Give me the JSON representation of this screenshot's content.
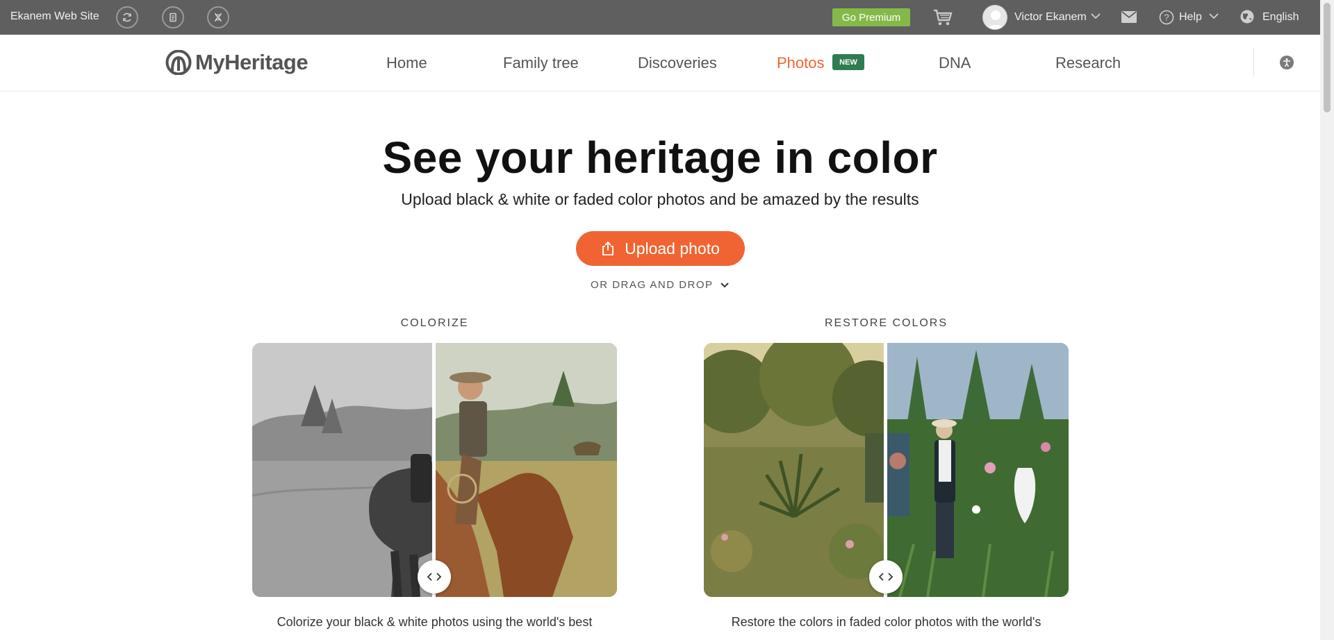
{
  "topbar": {
    "site_name": "Ekanem Web Site",
    "go_premium": "Go Premium",
    "user_name": "Victor Ekanem",
    "help": "Help",
    "language": "English"
  },
  "nav": {
    "logo_text": "MyHeritage",
    "items": [
      {
        "label": "Home"
      },
      {
        "label": "Family tree"
      },
      {
        "label": "Discoveries"
      },
      {
        "label": "Photos",
        "active": true
      },
      {
        "label": "DNA"
      },
      {
        "label": "Research"
      }
    ],
    "new_badge": "NEW"
  },
  "hero": {
    "title": "See your heritage in color",
    "subtitle": "Upload black & white or faded color photos and be amazed by the results",
    "upload_button": "Upload photo",
    "drag_drop": "OR DRAG AND DROP"
  },
  "features": [
    {
      "title": "COLORIZE",
      "description": "Colorize your black & white photos using the world's best"
    },
    {
      "title": "RESTORE COLORS",
      "description": "Restore the colors in faded color photos with the world's"
    }
  ],
  "colors": {
    "accent": "#ef6432",
    "premium": "#84b94a",
    "badge": "#2e7d52",
    "topbar": "#5f5f5f"
  },
  "icons": [
    "sync-icon",
    "document-icon",
    "dna-icon",
    "cart-icon",
    "mail-icon",
    "help-icon",
    "globe-icon",
    "accessibility-icon",
    "upload-icon",
    "chevron-down-icon",
    "compare-arrows-icon"
  ]
}
